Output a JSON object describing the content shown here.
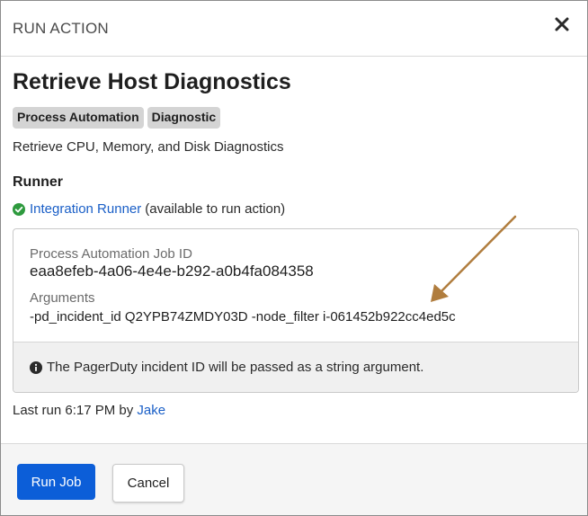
{
  "modal": {
    "header_title": "RUN ACTION",
    "close_glyph": "×"
  },
  "action": {
    "title": "Retrieve Host Diagnostics",
    "tags": [
      "Process Automation",
      "Diagnostic"
    ],
    "description": "Retrieve CPU, Memory, and Disk Diagnostics"
  },
  "runner": {
    "heading": "Runner",
    "link_label": "Integration Runner",
    "status_text": "(available to run action)",
    "status_icon": "check-circle-icon",
    "status_color": "#2e9a3e"
  },
  "job": {
    "id_label": "Process Automation Job ID",
    "id_value": "eaa8efeb-4a06-4e4e-b292-a0b4fa084358",
    "args_label": "Arguments",
    "args_value": "-pd_incident_id Q2YPB74ZMDY03D -node_filter i-061452b922cc4ed5c",
    "info_icon": "info-circle-icon",
    "info_text": "The PagerDuty incident ID will be passed as a string argument."
  },
  "last_run": {
    "prefix": "Last run 6:17 PM by",
    "user": "Jake"
  },
  "footer": {
    "run_label": "Run Job",
    "cancel_label": "Cancel"
  },
  "colors": {
    "primary": "#0c5ed8",
    "link": "#1a5fc7",
    "annotation_arrow": "#b07d3e"
  }
}
